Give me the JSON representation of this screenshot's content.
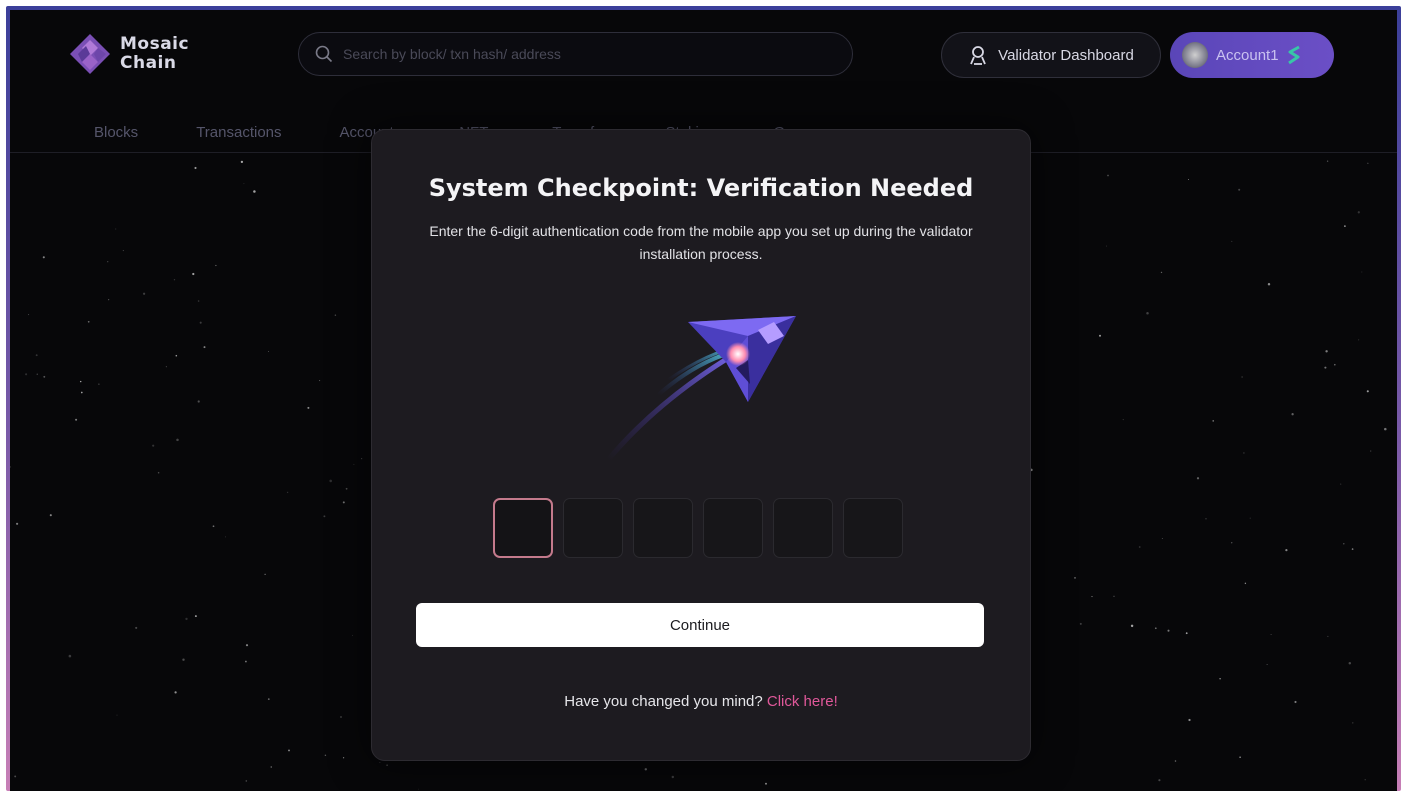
{
  "brand": {
    "name_line1": "Mosaic",
    "name_line2": "Chain",
    "logo_icon": "mosaic-diamond-logo"
  },
  "search": {
    "placeholder": "Search by block/ txn hash/ address",
    "icon": "search-icon"
  },
  "header": {
    "validator_label": "Validator Dashboard",
    "validator_icon": "user-badge-icon",
    "account_label": "Account1",
    "account_icon": "avatar",
    "wallet_icon": "s-token-icon"
  },
  "nav": {
    "items": [
      {
        "label": "Blocks"
      },
      {
        "label": "Transactions"
      },
      {
        "label": "Accounts"
      },
      {
        "label": "NFTs"
      },
      {
        "label": "Transfer"
      },
      {
        "label": "Staking"
      },
      {
        "label": "Governance"
      }
    ]
  },
  "modal": {
    "title": "System Checkpoint: Verification Needed",
    "description": "Enter the 6-digit authentication code from the mobile app you set up during the validator installation process.",
    "illustration": "rocket-ship-illustration",
    "code_digits": [
      "",
      "",
      "",
      "",
      "",
      ""
    ],
    "active_digit_index": 0,
    "continue_label": "Continue",
    "footer_text": "Have you changed you mind?",
    "footer_link": "Click here!"
  },
  "colors": {
    "background": "#070709",
    "modal_bg": "#1d1b20",
    "accent_pink": "#e0589a",
    "account_purple": "#5a46b8",
    "active_digit_border": "#c47a8c"
  }
}
